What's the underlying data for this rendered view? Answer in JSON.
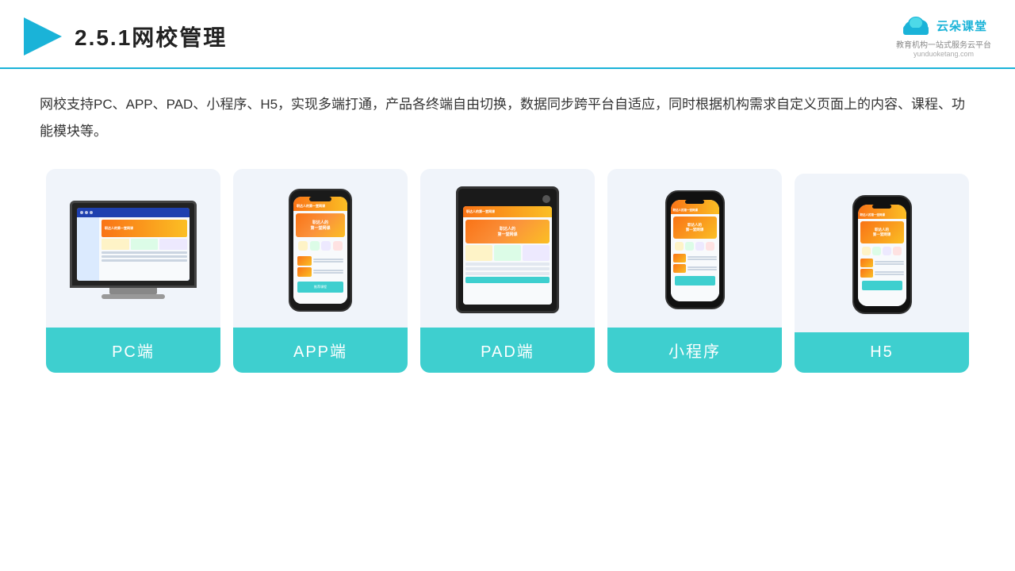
{
  "header": {
    "title_prefix": "2.5.1",
    "title_main": "网校管理",
    "logo_text": "云朵课堂",
    "logo_url": "yunduoketang.com",
    "logo_tagline": "教育机构一站\n式服务云平台"
  },
  "description": "网校支持PC、APP、PAD、小程序、H5，实现多端打通，产品各终端自由切换，数据同步跨平台自适应，同时根据机构需求自定义页面上的内容、课程、功能模块等。",
  "cards": [
    {
      "id": "pc",
      "label": "PC端"
    },
    {
      "id": "app",
      "label": "APP端"
    },
    {
      "id": "pad",
      "label": "PAD端"
    },
    {
      "id": "miniapp",
      "label": "小程序"
    },
    {
      "id": "h5",
      "label": "H5"
    }
  ],
  "colors": {
    "teal": "#3ecfcf",
    "header_line": "#1ab3d8",
    "title_color": "#333333",
    "logo_color": "#1ab3d8",
    "text_color": "#333333",
    "card_bg": "#edf2f9"
  }
}
